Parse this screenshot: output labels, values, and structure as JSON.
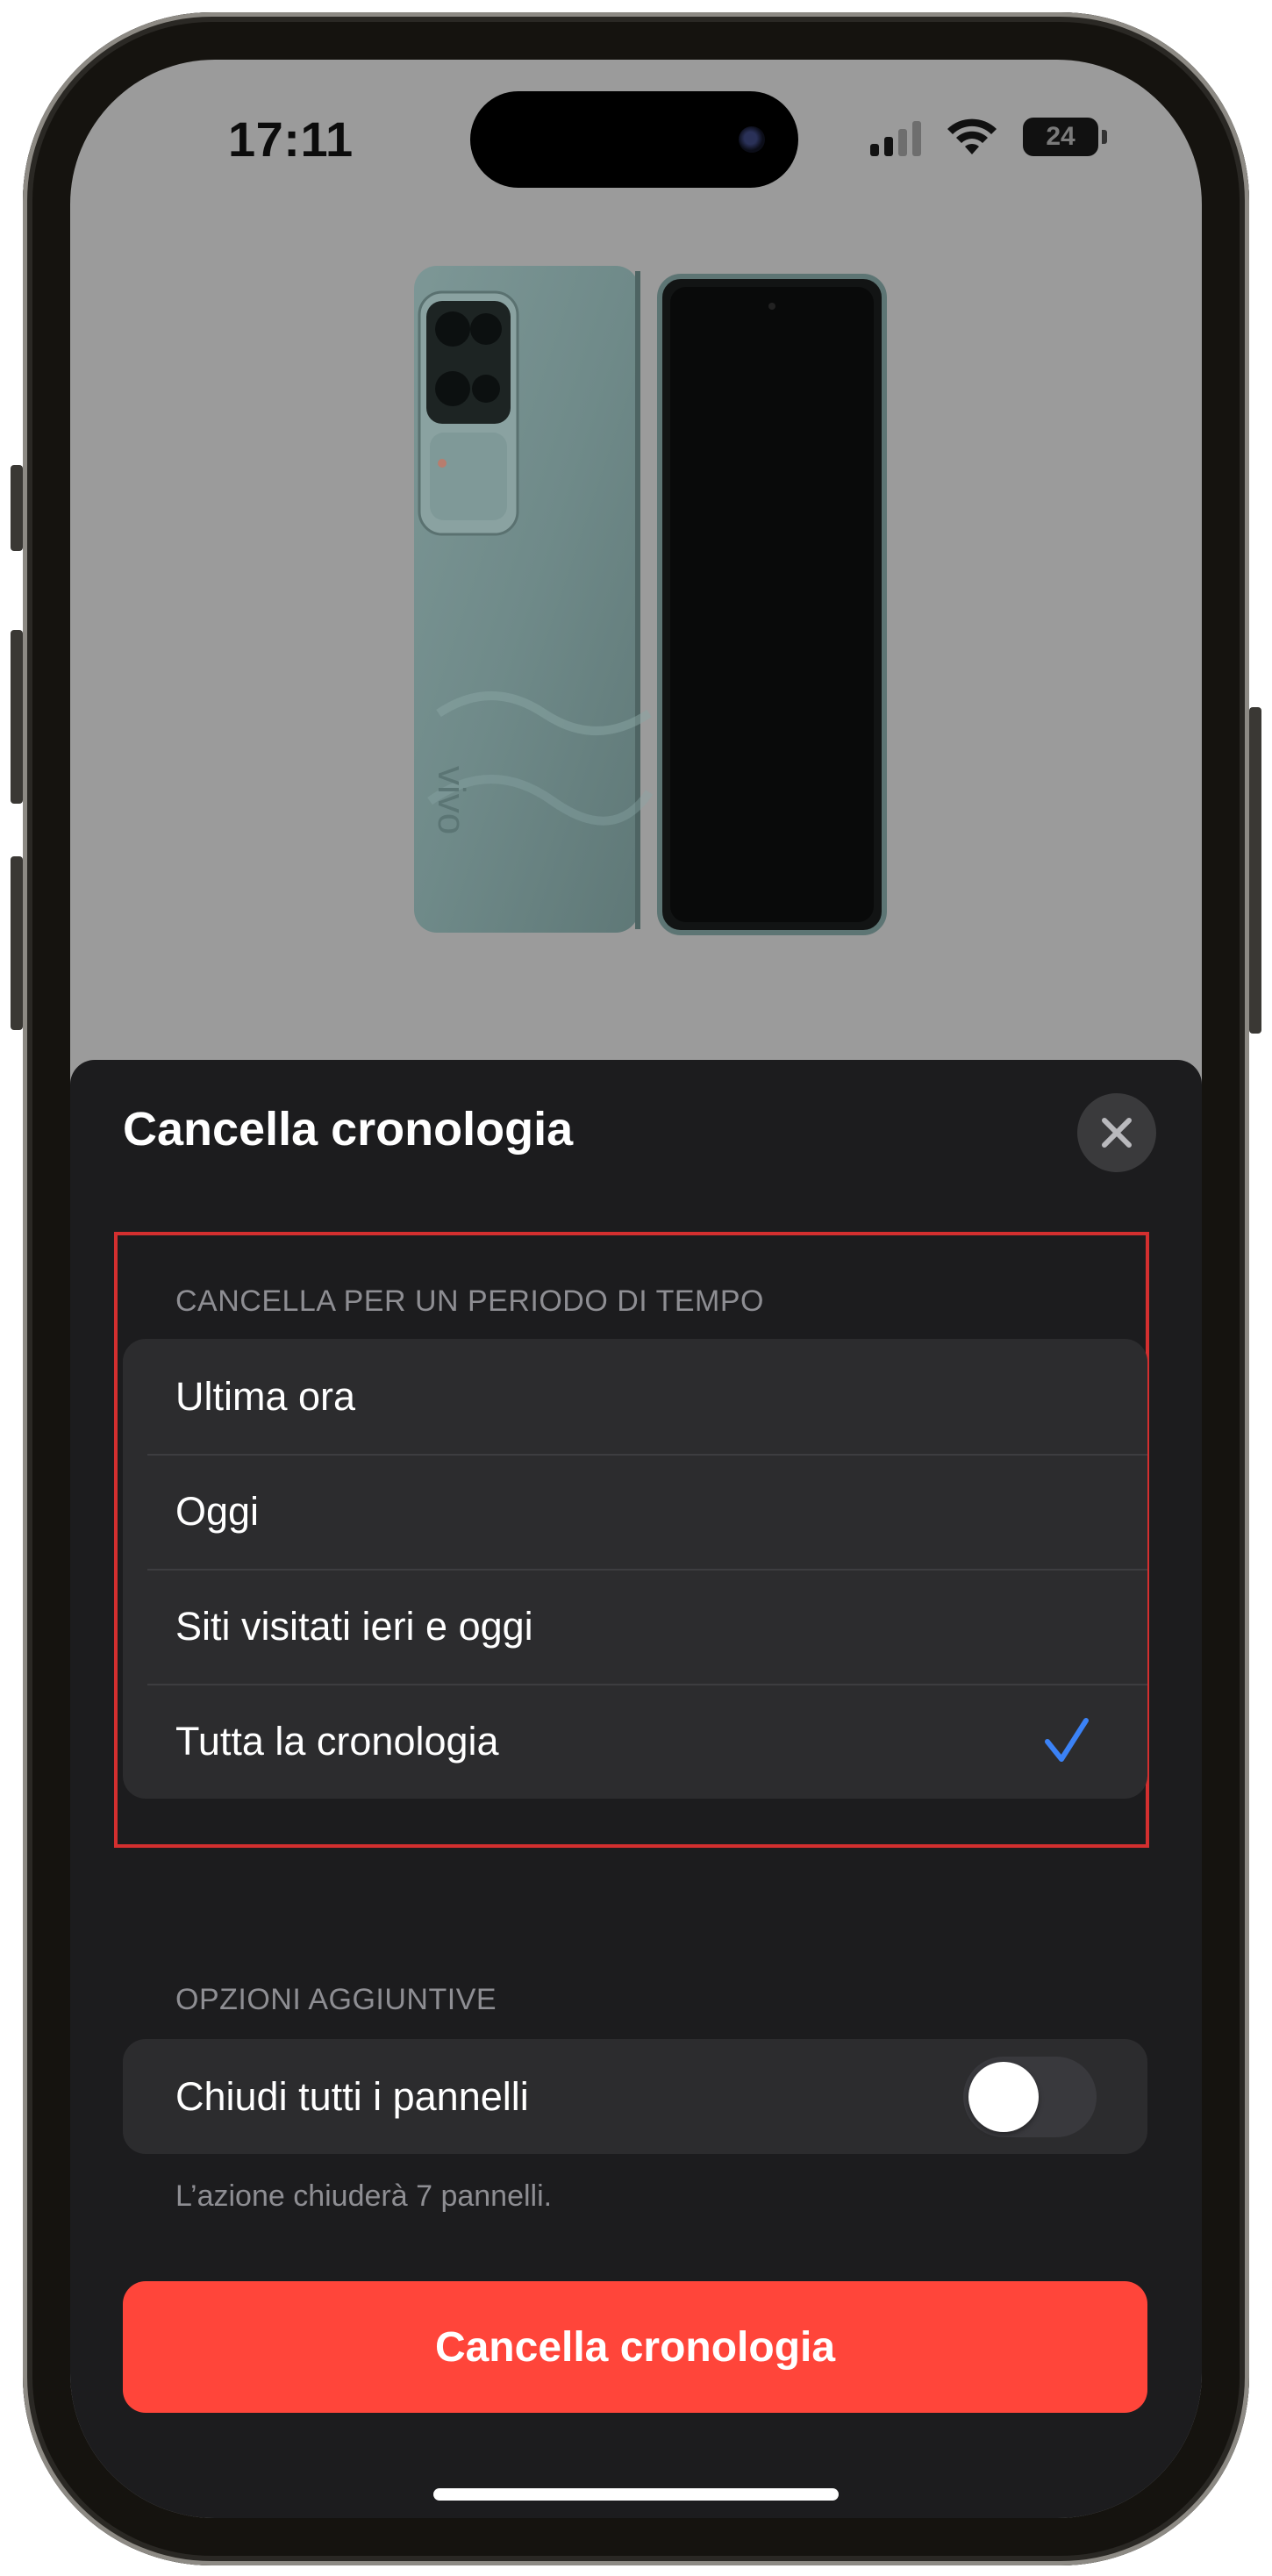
{
  "status_bar": {
    "time": "17:11",
    "battery_level": "24",
    "signal_bars": 4,
    "signal_bars_active": 2,
    "icons": [
      "cellular-signal-icon",
      "wifi-icon",
      "battery-icon"
    ]
  },
  "background": {
    "image": "smartphone-product-photo",
    "brand_text": "vivo"
  },
  "sheet": {
    "title": "Cancella cronologia",
    "close_icon": "close-icon",
    "time_section": {
      "header": "CANCELLA PER UN PERIODO DI TEMPO",
      "options": [
        {
          "label": "Ultima ora",
          "selected": false
        },
        {
          "label": "Oggi",
          "selected": false
        },
        {
          "label": "Siti visitati ieri e oggi",
          "selected": false
        },
        {
          "label": "Tutta la cronologia",
          "selected": true
        }
      ]
    },
    "extra_section": {
      "header": "OPZIONI AGGIUNTIVE",
      "toggle_label": "Chiudi tutti i pannelli",
      "toggle_on": false,
      "footnote": "L’azione chiuderà 7 pannelli."
    },
    "action_button": "Cancella cronologia"
  },
  "colors": {
    "sheet_bg": "#1c1c1e",
    "row_bg": "#2c2c2e",
    "accent_blue": "#3b82f6",
    "destructive_red": "#ff453a",
    "highlight_box": "#d32f2f",
    "secondary_text": "#8e8e93"
  }
}
